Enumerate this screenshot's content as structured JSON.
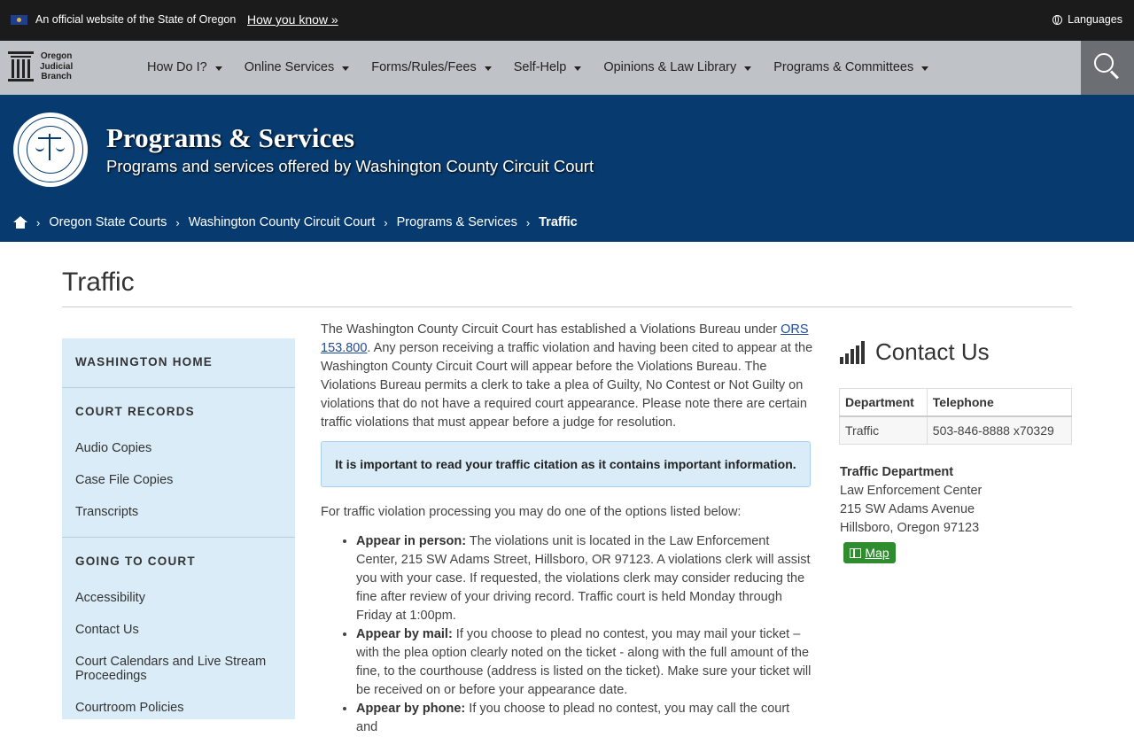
{
  "banner": {
    "official_text": "An official website of the State of Oregon",
    "how_you_know": "How you know »",
    "languages": "Languages"
  },
  "nav": {
    "logo_line1": "Oregon",
    "logo_line2": "Judicial",
    "logo_line3": "Branch",
    "items": [
      "How Do I?",
      "Online Services",
      "Forms/Rules/Fees",
      "Self-Help",
      "Opinions & Law Library",
      "Programs & Committees"
    ]
  },
  "hero": {
    "title": "Programs & Services",
    "subtitle": "Programs and services offered by Washington County Circuit Court"
  },
  "breadcrumb": {
    "items": [
      "Oregon State Courts",
      "Washington County Circuit Court",
      "Programs & Services"
    ],
    "current": "Traffic"
  },
  "page": {
    "title": "Traffic"
  },
  "sidebar": {
    "home": "WASHINGTON HOME",
    "section1": "COURT RECORDS",
    "records": [
      "Audio Copies",
      "Case File Copies",
      "Transcripts"
    ],
    "section2": "GOING TO COURT",
    "court": [
      "Accessibility",
      "Contact Us",
      "Court Calendars and Live Stream Proceedings",
      "Courtroom Policies"
    ]
  },
  "main": {
    "intro_before": "The Washington County Circuit Court has established a Violations Bureau under ",
    "intro_link": "ORS 153.800",
    "intro_after": ". Any person receiving a traffic violation and having been cited to appear at the Washington County Circuit Court will appear before the Violations Bureau. The Violations Bureau permits a clerk to take a plea of Guilty, No Contest or Not Guilty on violations that do not have a required court appearance. Please note there are certain traffic violations that must appear before a judge for resolution.",
    "alert": "It is important to read your traffic citation as it contains important information.",
    "options_intro": "For traffic violation processing you may do one of the options listed below:",
    "options": [
      {
        "label": "Appear in person:",
        "text": " The violations unit is located in the Law Enforcement Center, 215 SW Adams Street, Hillsboro, OR 97123. A violations clerk will assist you with your case. If requested, the violations clerk may consider reducing the fine after review of your driving record. Traffic court is held Monday through Friday at 1:00pm."
      },
      {
        "label": "Appear by mail:",
        "text": " If you choose to plead no contest, you may mail your ticket – with the plea option clearly noted on the ticket - along with the full amount of the fine, to the courthouse (address is listed on the ticket). Make sure your ticket will be received on or before your appearance date."
      },
      {
        "label": "Appear by phone:",
        "text": " If you choose to plead no contest, you may call the court and"
      }
    ]
  },
  "contact": {
    "title": "Contact Us",
    "col_department": "Department",
    "col_telephone": "Telephone",
    "row_department": "Traffic",
    "row_telephone": "503-846-8888 x70329",
    "dept_name": "Traffic Department",
    "addr1": "Law Enforcement Center",
    "addr2": "215 SW Adams Avenue",
    "addr3": "Hillsboro, Oregon 97123",
    "map": "Map"
  }
}
